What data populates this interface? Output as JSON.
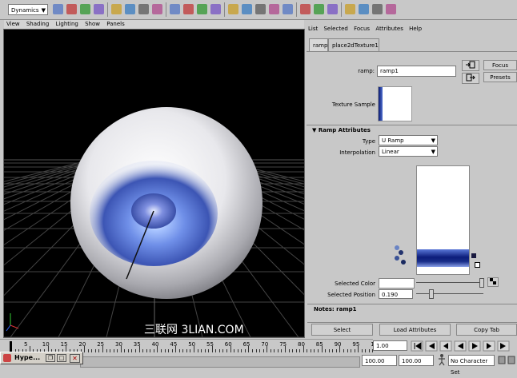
{
  "toolbar": {
    "menu_set": "Dynamics",
    "icons": [
      "new-scene",
      "open-scene",
      "save-scene",
      "render",
      "ipr",
      "select-hierarchy",
      "select-object",
      "select-component",
      "snap-grid",
      "snap-curve",
      "snap-point",
      "snap-surface",
      "history",
      "render-frame",
      "ipr-render",
      "render-settings",
      "hypershade",
      "show-hide",
      "bookmark",
      "layout",
      "cameras",
      "channel-box",
      "rotate",
      "scale"
    ]
  },
  "viewport": {
    "menu": [
      "View",
      "Shading",
      "Lighting",
      "Show",
      "Panels"
    ]
  },
  "attribute_editor": {
    "menu": [
      "List",
      "Selected",
      "Focus",
      "Attributes",
      "Help"
    ],
    "tabs": [
      "ramp1",
      "place2dTexture1"
    ],
    "node_label": "ramp:",
    "node_value": "ramp1",
    "focus_label": "Focus",
    "presets_label": "Presets",
    "texture_sample_label": "Texture Sample",
    "section_title": "Ramp Attributes",
    "type_label": "Type",
    "type_value": "U Ramp",
    "interpolation_label": "Interpolation",
    "interpolation_value": "Linear",
    "selected_color_label": "Selected Color",
    "selected_position_label": "Selected Position",
    "selected_position_value": "0.190",
    "notes_label": "Notes:",
    "notes_value": "ramp1",
    "select_label": "Select",
    "load_attributes_label": "Load Attributes",
    "copy_tab_label": "Copy Tab"
  },
  "watermark": "三联网 3LIAN.COM",
  "timeline": {
    "ticks": [
      "5",
      "10",
      "15",
      "20",
      "25",
      "30",
      "35",
      "40",
      "45",
      "50",
      "55",
      "60",
      "65",
      "70",
      "75",
      "80",
      "85",
      "90",
      "95",
      "1"
    ],
    "current_frame": "1.00"
  },
  "range": {
    "start": "100.00",
    "end": "100.00",
    "character_set": "No Character Set"
  },
  "hypershade_window": {
    "title": "Hype..."
  },
  "colors": {
    "ui_gray": "#c8c8c8",
    "ramp_blue": "#1a2f8a"
  }
}
